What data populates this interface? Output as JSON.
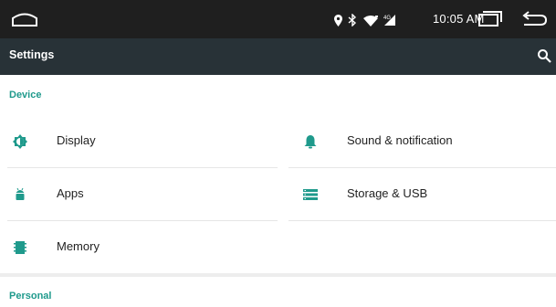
{
  "status_bar": {
    "time": "10:05 AM",
    "icons": [
      "home-icon",
      "location-icon",
      "bluetooth-icon",
      "wifi-icon",
      "signal-icon",
      "recents-icon",
      "back-icon"
    ]
  },
  "toolbar": {
    "title": "Settings",
    "search_icon": "search-icon"
  },
  "sections": [
    {
      "header": "Device",
      "items": [
        {
          "label": "Display",
          "icon": "display-brightness-icon"
        },
        {
          "label": "Sound & notification",
          "icon": "bell-icon"
        },
        {
          "label": "Apps",
          "icon": "android-icon"
        },
        {
          "label": "Storage & USB",
          "icon": "storage-icon"
        },
        {
          "label": "Memory",
          "icon": "memory-icon"
        }
      ]
    },
    {
      "header": "Personal",
      "items": []
    }
  ],
  "colors": {
    "accent": "#1f9a8c",
    "toolbar": "#283237",
    "statusbar": "#1f1f1f"
  }
}
